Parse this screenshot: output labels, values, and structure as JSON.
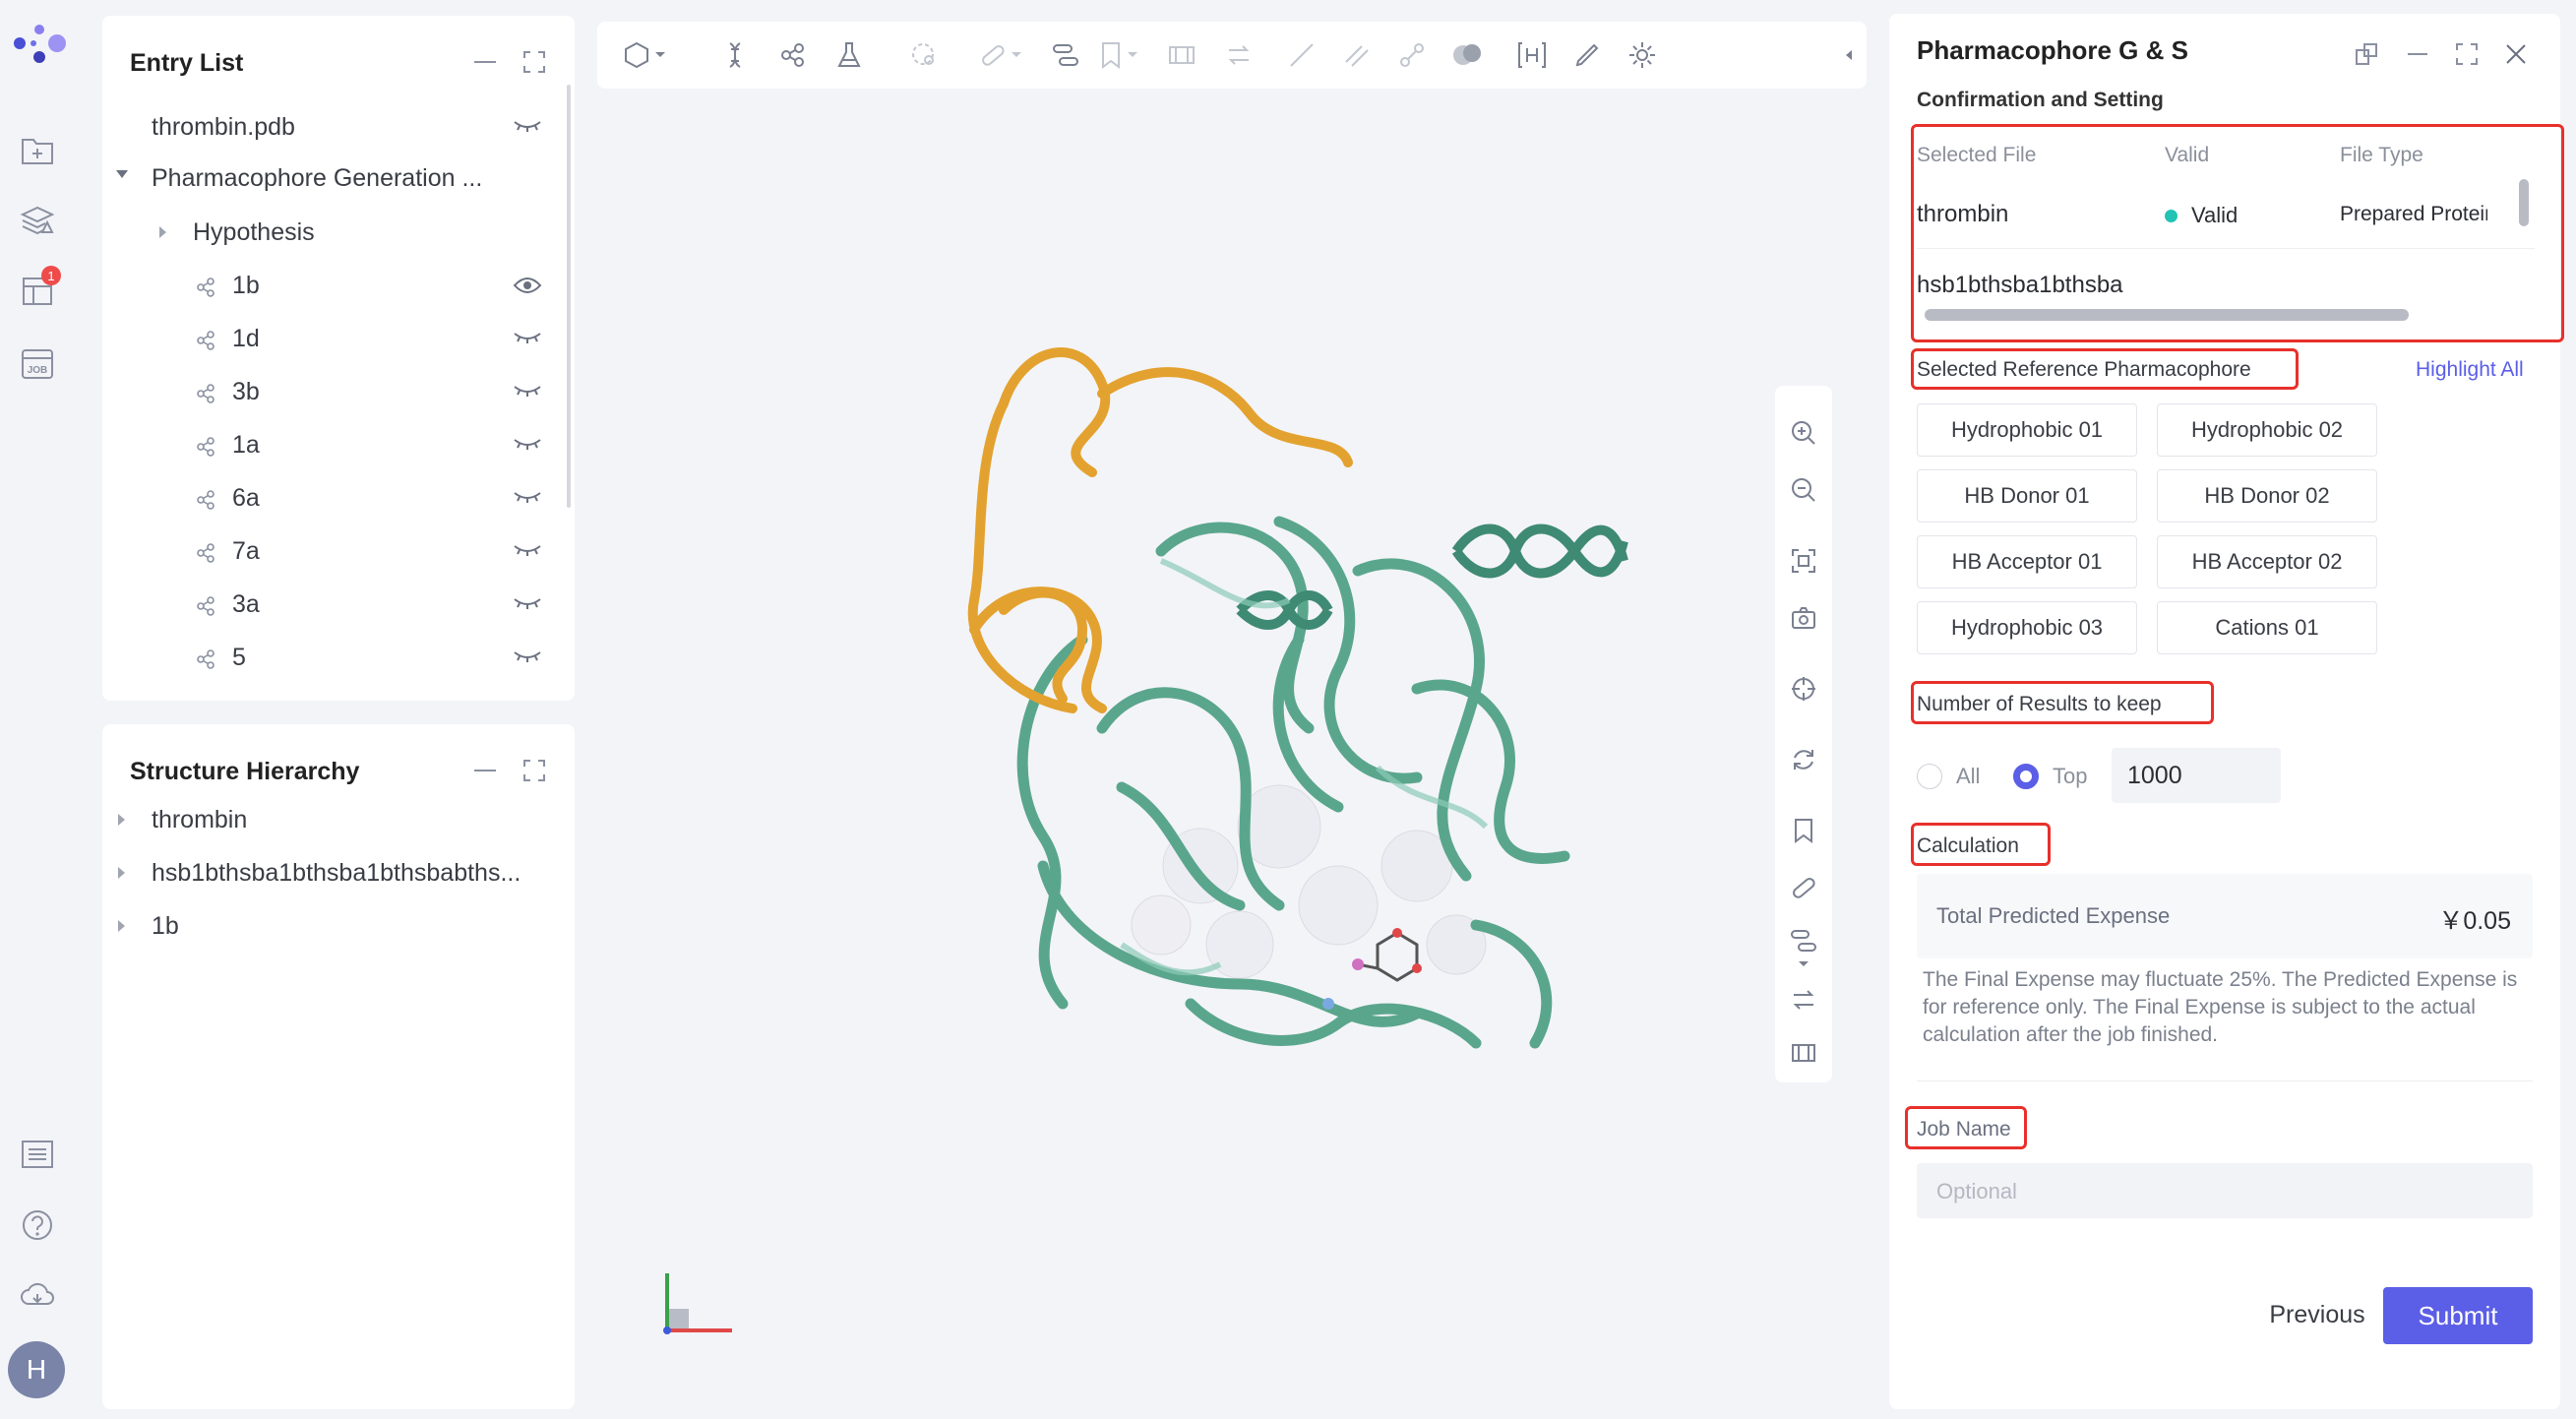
{
  "rail": {
    "items": [
      {
        "name": "new-project-icon"
      },
      {
        "name": "layers-icon"
      },
      {
        "name": "table-icon",
        "badge": "1"
      },
      {
        "name": "job-icon",
        "text": "JOB"
      }
    ],
    "bottom": [
      {
        "name": "list-icon"
      },
      {
        "name": "help-icon"
      },
      {
        "name": "cloud-icon"
      }
    ],
    "avatar_initial": "H"
  },
  "entry_list": {
    "title": "Entry List",
    "items": [
      {
        "label": "thrombin.pdb",
        "eye": "closed"
      },
      {
        "label": "Pharmacophore Generation ...",
        "expanded": true
      },
      {
        "label": "Hypothesis"
      },
      {
        "label": "1b",
        "eye": "open"
      },
      {
        "label": "1d",
        "eye": "closed"
      },
      {
        "label": "3b",
        "eye": "closed"
      },
      {
        "label": "1a",
        "eye": "closed"
      },
      {
        "label": "6a",
        "eye": "closed"
      },
      {
        "label": "7a",
        "eye": "closed"
      },
      {
        "label": "3a",
        "eye": "closed"
      },
      {
        "label": "5",
        "eye": "closed"
      }
    ]
  },
  "structure_hierarchy": {
    "title": "Structure Hierarchy",
    "items": [
      {
        "label": "thrombin"
      },
      {
        "label": "hsb1bthsba1bthsba1bthsbabths..."
      },
      {
        "label": "1b"
      }
    ]
  },
  "right_panel": {
    "title": "Pharmacophore G & S",
    "subtitle": "Confirmation and Setting",
    "file_table": {
      "headers": [
        "Selected File",
        "Valid",
        "File Type"
      ],
      "rows": [
        {
          "file": "thrombin",
          "valid": "Valid",
          "type": "Prepared Protein"
        },
        {
          "file": "hsb1bthsba1bthsba",
          "valid": "",
          "type": ""
        }
      ]
    },
    "ref_label": "Selected Reference Pharmacophore",
    "highlight_all": "Highlight All",
    "chips": [
      "Hydrophobic 01",
      "Hydrophobic 02",
      "HB Donor 01",
      "HB Donor 02",
      "HB Acceptor 01",
      "HB Acceptor 02",
      "Hydrophobic 03",
      "Cations 01"
    ],
    "results_label": "Number of Results to keep",
    "radio_all": "All",
    "radio_top": "Top",
    "top_value": "1000",
    "calc_label": "Calculation",
    "expense_label": "Total Predicted Expense",
    "expense_value": "￥0.05",
    "note": "The Final Expense may fluctuate 25%. The Predicted Expense is for reference only. The Final Expense is subject to the actual calculation after the job finished.",
    "job_label": "Job Name",
    "job_placeholder": "Optional",
    "previous": "Previous",
    "submit": "Submit"
  },
  "colors": {
    "accent": "#5b5ee6",
    "ribbon": "#5aa68c",
    "ribbon_dark": "#3f8a72",
    "loop": "#e3a22f",
    "highlight_box": "#e8302b",
    "valid_dot": "#22c3b5"
  }
}
